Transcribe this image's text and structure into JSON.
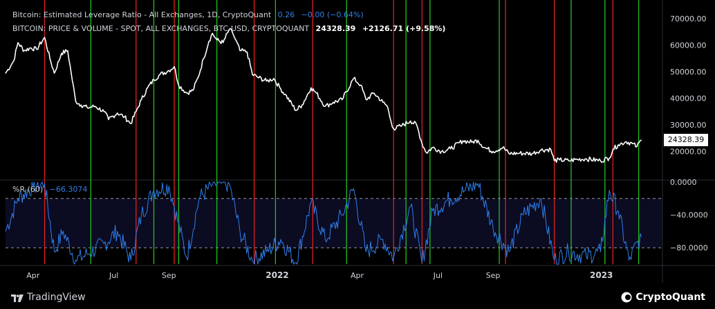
{
  "legend": {
    "line1_name": "Bitcoin: Estimated Leverage Ratio - All Exchanges, 1D, CryptoQuant",
    "line1_value": "0.26",
    "line1_change": "−0.00 (−0.64%)",
    "line2_name": "BITCOIN: PRICE & VOLUME - SPOT, ALL EXCHANGES, BTC-USD, CRYPTOQUANT",
    "line2_value": "24328.39",
    "line2_change": "+2126.71 (+9.58%)",
    "line3_name": "%R (60)",
    "line3_value": "−66.3074"
  },
  "price_badge": "24328.39",
  "footer": {
    "left_brand": "TradingView",
    "right_brand": "CryptoQuant"
  },
  "colors": {
    "price_line": "#ffffff",
    "wr_line": "#2f80ed",
    "green_marker": "#22c022",
    "red_marker": "#e02020",
    "band_fill": "#0b0b22",
    "grid_dash": "#9a9aa0"
  },
  "chart_data": [
    {
      "type": "line",
      "title": "BITCOIN: PRICE & VOLUME - SPOT, ALL EXCHANGES, BTC-USD, CRYPTOQUANT",
      "ylim": [
        10000,
        75000
      ],
      "y_ticks": [
        "70000.00",
        "60000.00",
        "50000.00",
        "40000.00",
        "30000.00",
        "20000.00"
      ],
      "y_tick_values": [
        70000,
        60000,
        50000,
        40000,
        30000,
        20000
      ],
      "x_tick_labels": [
        "Apr",
        "Jul",
        "Sep",
        "2022",
        "Apr",
        "Jul",
        "Sep",
        "2023"
      ],
      "x_tick_dates": [
        "2021-04-01",
        "2021-07-01",
        "2021-09-01",
        "2022-01-01",
        "2022-04-01",
        "2022-07-01",
        "2022-09-01",
        "2023-01-01"
      ],
      "xlim": [
        "2021-03-01",
        "2023-03-10"
      ],
      "series": [
        {
          "name": "BITCOIN: PRICE & VOLUME - SPOT, ALL EXCHANGES, BTC-USD, CRYPTOQUANT",
          "x": [
            "2021-03-01",
            "2021-03-10",
            "2021-03-15",
            "2021-03-22",
            "2021-03-29",
            "2021-04-05",
            "2021-04-14",
            "2021-04-20",
            "2021-04-25",
            "2021-05-03",
            "2021-05-10",
            "2021-05-14",
            "2021-05-19",
            "2021-05-25",
            "2021-06-01",
            "2021-06-10",
            "2021-06-20",
            "2021-06-25",
            "2021-07-05",
            "2021-07-13",
            "2021-07-20",
            "2021-07-26",
            "2021-08-01",
            "2021-08-08",
            "2021-08-15",
            "2021-08-22",
            "2021-09-01",
            "2021-09-07",
            "2021-09-12",
            "2021-09-21",
            "2021-09-28",
            "2021-10-04",
            "2021-10-10",
            "2021-10-16",
            "2021-10-20",
            "2021-10-25",
            "2021-11-01",
            "2021-11-08",
            "2021-11-12",
            "2021-11-20",
            "2021-11-28",
            "2021-12-04",
            "2021-12-10",
            "2021-12-20",
            "2021-12-28",
            "2022-01-05",
            "2022-01-10",
            "2022-01-22",
            "2022-01-29",
            "2022-02-08",
            "2022-02-14",
            "2022-02-24",
            "2022-03-05",
            "2022-03-15",
            "2022-03-28",
            "2022-04-05",
            "2022-04-11",
            "2022-04-20",
            "2022-04-30",
            "2022-05-05",
            "2022-05-09",
            "2022-05-12",
            "2022-05-20",
            "2022-05-31",
            "2022-06-07",
            "2022-06-13",
            "2022-06-18",
            "2022-06-25",
            "2022-07-05",
            "2022-07-15",
            "2022-07-29",
            "2022-08-08",
            "2022-08-15",
            "2022-08-22",
            "2022-09-01",
            "2022-09-12",
            "2022-09-19",
            "2022-10-01",
            "2022-10-15",
            "2022-10-25",
            "2022-11-05",
            "2022-11-09",
            "2022-11-15",
            "2022-11-25",
            "2022-12-05",
            "2022-12-15",
            "2022-12-31",
            "2023-01-10",
            "2023-01-14",
            "2023-01-20",
            "2023-01-29",
            "2023-02-05",
            "2023-02-10",
            "2023-02-15"
          ],
          "values": [
            49500,
            54000,
            61000,
            58000,
            59000,
            58500,
            63000,
            55000,
            49500,
            57000,
            58000,
            49500,
            39000,
            37500,
            36500,
            37000,
            35000,
            32000,
            34500,
            33000,
            30500,
            35000,
            39500,
            44000,
            47000,
            49000,
            50500,
            52000,
            45000,
            42000,
            43000,
            48000,
            55000,
            61500,
            64500,
            62000,
            61000,
            66000,
            64500,
            58000,
            57500,
            49000,
            48000,
            46500,
            47500,
            43500,
            41500,
            35500,
            37500,
            44000,
            42000,
            37000,
            38500,
            39500,
            47500,
            45000,
            39500,
            42000,
            38500,
            37000,
            31500,
            28500,
            29500,
            31500,
            30000,
            23000,
            19500,
            21500,
            20000,
            21000,
            24000,
            23500,
            24200,
            21500,
            20000,
            21500,
            19200,
            19300,
            19200,
            20500,
            20800,
            16500,
            16800,
            16500,
            17000,
            17200,
            16500,
            17500,
            20800,
            22500,
            23700,
            22900,
            21800,
            24300
          ]
        }
      ]
    },
    {
      "type": "line",
      "title": "%R (60)",
      "ylim": [
        -100,
        0
      ],
      "y_ticks": [
        "0.0000",
        "−40.0000",
        "−80.0000"
      ],
      "y_tick_values": [
        0,
        -40,
        -80
      ],
      "bands": [
        -20,
        -80
      ],
      "series": [
        {
          "name": "%R (60)",
          "x": [
            "2021-03-01",
            "2021-03-15",
            "2021-04-01",
            "2021-04-14",
            "2021-04-25",
            "2021-05-05",
            "2021-05-19",
            "2021-06-01",
            "2021-06-20",
            "2021-07-05",
            "2021-07-20",
            "2021-08-01",
            "2021-08-15",
            "2021-09-01",
            "2021-09-07",
            "2021-09-21",
            "2021-10-05",
            "2021-10-20",
            "2021-11-08",
            "2021-11-20",
            "2021-12-04",
            "2021-12-20",
            "2022-01-05",
            "2022-01-22",
            "2022-02-08",
            "2022-02-24",
            "2022-03-15",
            "2022-03-28",
            "2022-04-11",
            "2022-04-30",
            "2022-05-12",
            "2022-05-31",
            "2022-06-13",
            "2022-06-25",
            "2022-07-15",
            "2022-08-01",
            "2022-08-15",
            "2022-09-01",
            "2022-09-19",
            "2022-10-05",
            "2022-10-25",
            "2022-11-09",
            "2022-11-25",
            "2022-12-15",
            "2022-12-31",
            "2023-01-10",
            "2023-01-20",
            "2023-02-01",
            "2023-02-15"
          ],
          "values": [
            -60,
            -20,
            -5,
            -2,
            -85,
            -60,
            -95,
            -88,
            -75,
            -60,
            -95,
            -40,
            -10,
            -5,
            -30,
            -92,
            -20,
            -3,
            -2,
            -60,
            -95,
            -85,
            -70,
            -98,
            -25,
            -70,
            -40,
            -8,
            -85,
            -70,
            -92,
            -30,
            -98,
            -35,
            -20,
            -10,
            -2,
            -55,
            -85,
            -40,
            -20,
            -95,
            -85,
            -90,
            -85,
            -10,
            -35,
            -95,
            -66.3074
          ]
        }
      ]
    },
    {
      "type": "vlines",
      "title": "signal markers",
      "green_dates": [
        "2021-06-05",
        "2021-08-15",
        "2021-09-12",
        "2021-10-25",
        "2021-12-30",
        "2022-03-20",
        "2022-05-26",
        "2022-06-22",
        "2022-09-08",
        "2022-11-28",
        "2023-01-05",
        "2023-02-12"
      ],
      "red_dates": [
        "2021-04-14",
        "2021-07-26",
        "2021-09-07",
        "2021-12-06",
        "2022-02-10",
        "2022-05-12",
        "2022-06-13",
        "2022-09-15",
        "2022-11-09",
        "2023-01-14"
      ]
    }
  ]
}
